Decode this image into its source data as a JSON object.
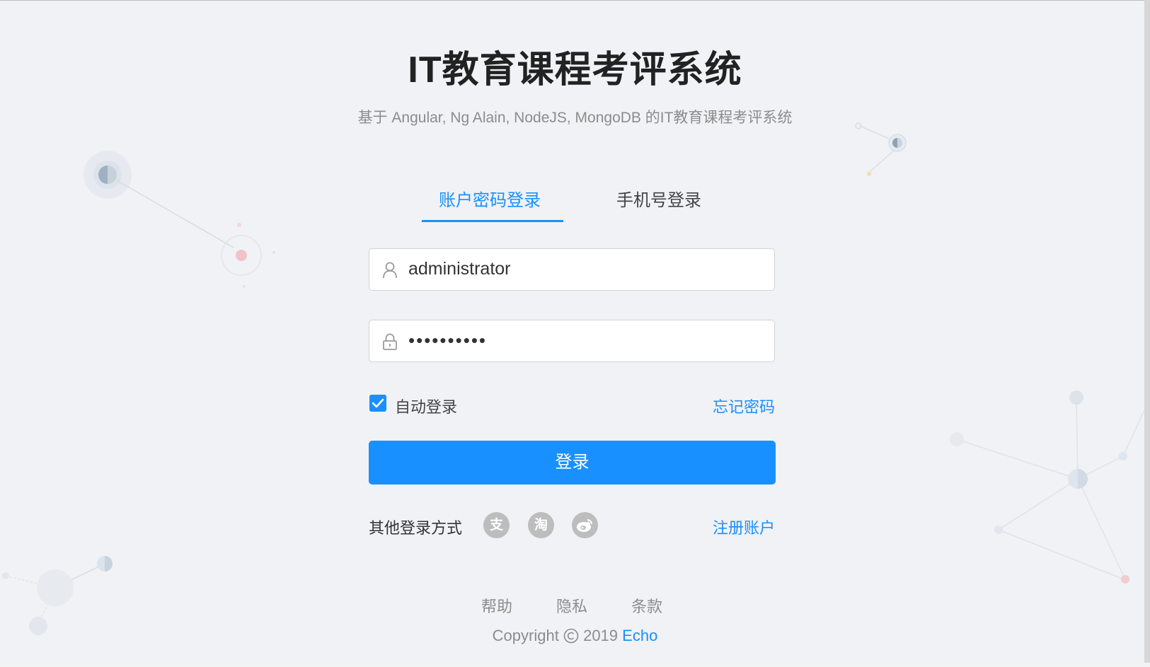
{
  "header": {
    "title": "IT教育课程考评系统",
    "subtitle": "基于 Angular, Ng Alain, NodeJS, MongoDB 的IT教育课程考评系统"
  },
  "tabs": [
    {
      "label": "账户密码登录",
      "active": true
    },
    {
      "label": "手机号登录",
      "active": false
    }
  ],
  "form": {
    "username_value": "administrator",
    "password_masked": "••••••••••",
    "remember_label": "自动登录",
    "remember_checked": true,
    "forgot_label": "忘记密码",
    "submit_label": "登录"
  },
  "other_login": {
    "label": "其他登录方式",
    "providers": [
      {
        "icon": "alipay-icon",
        "glyph": "支"
      },
      {
        "icon": "taobao-icon",
        "glyph": "淘"
      },
      {
        "icon": "weibo-icon",
        "glyph": "微"
      }
    ],
    "register_label": "注册账户"
  },
  "footer": {
    "links": [
      "帮助",
      "隐私",
      "条款"
    ],
    "copyright_prefix": "Copyright",
    "copyright_year": "2019",
    "copyright_brand": "Echo"
  },
  "colors": {
    "accent": "#1890ff",
    "background": "#f0f2f5",
    "social_icon": "#bdbdbd"
  }
}
